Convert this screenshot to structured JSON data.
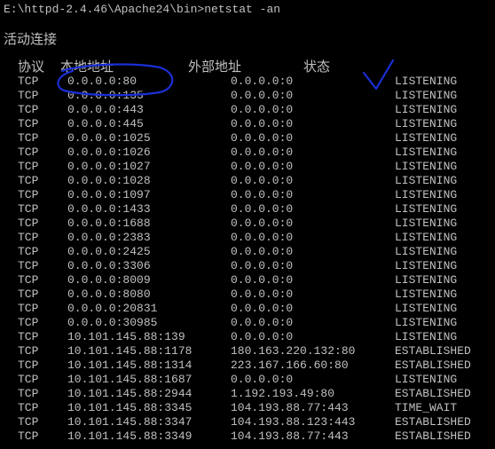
{
  "console": {
    "command_line": "E:\\httpd-2.4.46\\Apache24\\bin>netstat -an",
    "section_title": "活动连接",
    "headers": {
      "proto": "协议",
      "local": "本地地址",
      "foreign": "外部地址",
      "state": "状态"
    },
    "rows": [
      {
        "proto": "TCP",
        "local": "0.0.0.0:80",
        "foreign": "0.0.0.0:0",
        "state": "LISTENING"
      },
      {
        "proto": "TCP",
        "local": "0.0.0.0:135",
        "foreign": "0.0.0.0:0",
        "state": "LISTENING"
      },
      {
        "proto": "TCP",
        "local": "0.0.0.0:443",
        "foreign": "0.0.0.0:0",
        "state": "LISTENING"
      },
      {
        "proto": "TCP",
        "local": "0.0.0.0:445",
        "foreign": "0.0.0.0:0",
        "state": "LISTENING"
      },
      {
        "proto": "TCP",
        "local": "0.0.0.0:1025",
        "foreign": "0.0.0.0:0",
        "state": "LISTENING"
      },
      {
        "proto": "TCP",
        "local": "0.0.0.0:1026",
        "foreign": "0.0.0.0:0",
        "state": "LISTENING"
      },
      {
        "proto": "TCP",
        "local": "0.0.0.0:1027",
        "foreign": "0.0.0.0:0",
        "state": "LISTENING"
      },
      {
        "proto": "TCP",
        "local": "0.0.0.0:1028",
        "foreign": "0.0.0.0:0",
        "state": "LISTENING"
      },
      {
        "proto": "TCP",
        "local": "0.0.0.0:1097",
        "foreign": "0.0.0.0:0",
        "state": "LISTENING"
      },
      {
        "proto": "TCP",
        "local": "0.0.0.0:1433",
        "foreign": "0.0.0.0:0",
        "state": "LISTENING"
      },
      {
        "proto": "TCP",
        "local": "0.0.0.0:1688",
        "foreign": "0.0.0.0:0",
        "state": "LISTENING"
      },
      {
        "proto": "TCP",
        "local": "0.0.0.0:2383",
        "foreign": "0.0.0.0:0",
        "state": "LISTENING"
      },
      {
        "proto": "TCP",
        "local": "0.0.0.0:2425",
        "foreign": "0.0.0.0:0",
        "state": "LISTENING"
      },
      {
        "proto": "TCP",
        "local": "0.0.0.0:3306",
        "foreign": "0.0.0.0:0",
        "state": "LISTENING"
      },
      {
        "proto": "TCP",
        "local": "0.0.0.0:8009",
        "foreign": "0.0.0.0:0",
        "state": "LISTENING"
      },
      {
        "proto": "TCP",
        "local": "0.0.0.0:8080",
        "foreign": "0.0.0.0:0",
        "state": "LISTENING"
      },
      {
        "proto": "TCP",
        "local": "0.0.0.0:20831",
        "foreign": "0.0.0.0:0",
        "state": "LISTENING"
      },
      {
        "proto": "TCP",
        "local": "0.0.0.0:30985",
        "foreign": "0.0.0.0:0",
        "state": "LISTENING"
      },
      {
        "proto": "TCP",
        "local": "10.101.145.88:139",
        "foreign": "0.0.0.0:0",
        "state": "LISTENING"
      },
      {
        "proto": "TCP",
        "local": "10.101.145.88:1178",
        "foreign": "180.163.220.132:80",
        "state": "ESTABLISHED"
      },
      {
        "proto": "TCP",
        "local": "10.101.145.88:1314",
        "foreign": "223.167.166.60:80",
        "state": "ESTABLISHED"
      },
      {
        "proto": "TCP",
        "local": "10.101.145.88:1687",
        "foreign": "0.0.0.0:0",
        "state": "LISTENING"
      },
      {
        "proto": "TCP",
        "local": "10.101.145.88:2944",
        "foreign": "1.192.193.49:80",
        "state": "ESTABLISHED"
      },
      {
        "proto": "TCP",
        "local": "10.101.145.88:3345",
        "foreign": "104.193.88.77:443",
        "state": "TIME_WAIT"
      },
      {
        "proto": "TCP",
        "local": "10.101.145.88:3347",
        "foreign": "104.193.88.123:443",
        "state": "ESTABLISHED"
      },
      {
        "proto": "TCP",
        "local": "10.101.145.88:3349",
        "foreign": "104.193.88.77:443",
        "state": "ESTABLISHED"
      }
    ]
  },
  "colors": {
    "background": "#000000",
    "text": "#c0c0c0",
    "annotation": "#1a2fd6"
  }
}
